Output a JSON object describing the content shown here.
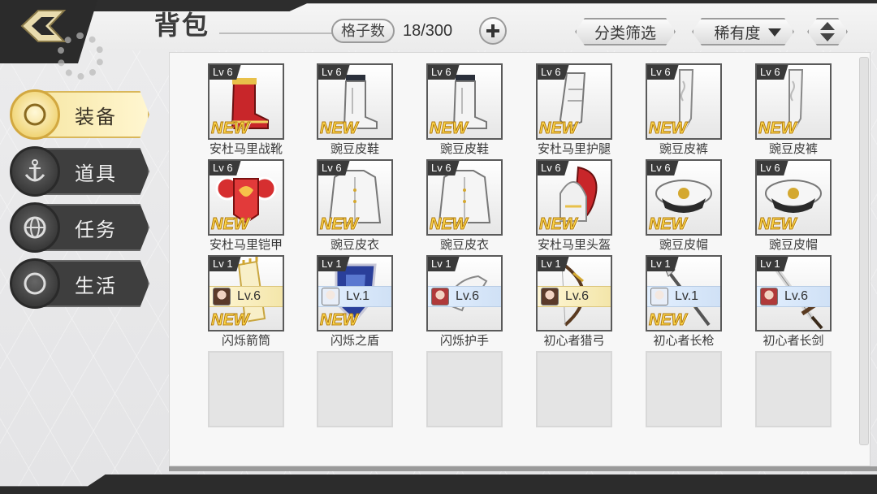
{
  "header": {
    "title": "背包",
    "slot_label": "格子数",
    "slot_value": "18/300",
    "filter_label": "分类筛选",
    "rarity_label": "稀有度"
  },
  "sidebar": {
    "tabs": [
      {
        "label": "装备",
        "icon": "equipment-emblem-icon",
        "active": true
      },
      {
        "label": "道具",
        "icon": "anchor-icon",
        "active": false
      },
      {
        "label": "任务",
        "icon": "globe-icon",
        "active": false
      },
      {
        "label": "生活",
        "icon": "moon-emblem-icon",
        "active": false
      }
    ]
  },
  "items": [
    {
      "name": "安杜马里战靴",
      "level": "Lv 6",
      "new": "NEW",
      "art": "red-boot",
      "equipped": null
    },
    {
      "name": "豌豆皮鞋",
      "level": "Lv 6",
      "new": "NEW",
      "art": "white-boot",
      "equipped": null
    },
    {
      "name": "豌豆皮鞋",
      "level": "Lv 6",
      "new": "NEW",
      "art": "white-boot",
      "equipped": null
    },
    {
      "name": "安杜马里护腿",
      "level": "Lv 6",
      "new": "NEW",
      "art": "leg-guard",
      "equipped": null
    },
    {
      "name": "豌豆皮裤",
      "level": "Lv 6",
      "new": "NEW",
      "art": "white-pants",
      "equipped": null
    },
    {
      "name": "豌豆皮裤",
      "level": "Lv 6",
      "new": "NEW",
      "art": "white-pants",
      "equipped": null
    },
    {
      "name": "安杜马里铠甲",
      "level": "Lv 6",
      "new": "NEW",
      "art": "red-armor",
      "equipped": null
    },
    {
      "name": "豌豆皮衣",
      "level": "Lv 6",
      "new": "NEW",
      "art": "white-coat",
      "equipped": null
    },
    {
      "name": "豌豆皮衣",
      "level": "Lv 6",
      "new": "NEW",
      "art": "white-coat",
      "equipped": null
    },
    {
      "name": "安杜马里头盔",
      "level": "Lv 6",
      "new": "NEW",
      "art": "red-helmet",
      "equipped": null
    },
    {
      "name": "豌豆皮帽",
      "level": "Lv 6",
      "new": "NEW",
      "art": "captain-hat",
      "equipped": null
    },
    {
      "name": "豌豆皮帽",
      "level": "Lv 6",
      "new": "NEW",
      "art": "captain-hat",
      "equipped": null
    },
    {
      "name": "闪烁箭筒",
      "level": "Lv 1",
      "new": "NEW",
      "art": "quiver",
      "equipped": {
        "lv": "Lv.6",
        "avatar": "brown",
        "bar": "gold"
      }
    },
    {
      "name": "闪烁之盾",
      "level": "Lv 1",
      "new": "NEW",
      "art": "shield",
      "equipped": {
        "lv": "Lv.1",
        "avatar": "white",
        "bar": "blue"
      }
    },
    {
      "name": "闪烁护手",
      "level": "Lv 1",
      "new": "",
      "art": "gauntlet",
      "equipped": {
        "lv": "Lv.6",
        "avatar": "red",
        "bar": "blue"
      }
    },
    {
      "name": "初心者猎弓",
      "level": "Lv 1",
      "new": "",
      "art": "bow",
      "equipped": {
        "lv": "Lv.6",
        "avatar": "brown",
        "bar": "gold"
      }
    },
    {
      "name": "初心者长枪",
      "level": "Lv 1",
      "new": "NEW",
      "art": "spear",
      "equipped": {
        "lv": "Lv.1",
        "avatar": "white",
        "bar": "blue"
      }
    },
    {
      "name": "初心者长剑",
      "level": "Lv 1",
      "new": "",
      "art": "sword",
      "equipped": {
        "lv": "Lv.6",
        "avatar": "red",
        "bar": "blue"
      }
    }
  ],
  "empty_slots": 6
}
